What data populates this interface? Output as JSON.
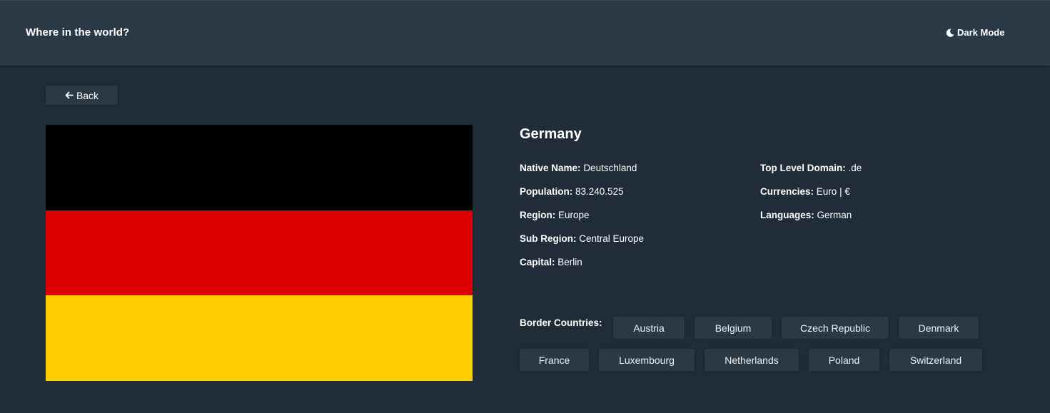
{
  "header": {
    "title": "Where in the world?",
    "mode_label": "Dark Mode",
    "mode_icon": "moon-icon"
  },
  "back": {
    "label": "Back",
    "icon": "arrow-left-icon"
  },
  "flag": {
    "name": "Germany flag",
    "colors": [
      "#000000",
      "#dd0000",
      "#ffce00"
    ]
  },
  "country": {
    "name": "Germany",
    "details_left": [
      {
        "label": "Native Name:",
        "value": "Deutschland"
      },
      {
        "label": "Population:",
        "value": "83.240.525"
      },
      {
        "label": "Region:",
        "value": "Europe"
      },
      {
        "label": "Sub Region:",
        "value": "Central Europe"
      },
      {
        "label": "Capital:",
        "value": "Berlin"
      }
    ],
    "details_right": [
      {
        "label": "Top Level Domain:",
        "value": ".de"
      },
      {
        "label": "Currencies:",
        "value": "Euro | €"
      },
      {
        "label": "Languages:",
        "value": "German"
      }
    ],
    "border_label": "Border Countries:",
    "borders": [
      "Austria",
      "Belgium",
      "Czech Republic",
      "Denmark",
      "France",
      "Luxembourg",
      "Netherlands",
      "Poland",
      "Switzerland"
    ]
  },
  "colors": {
    "background": "#202c37",
    "elements": "#2b3945",
    "text": "#ffffff"
  }
}
